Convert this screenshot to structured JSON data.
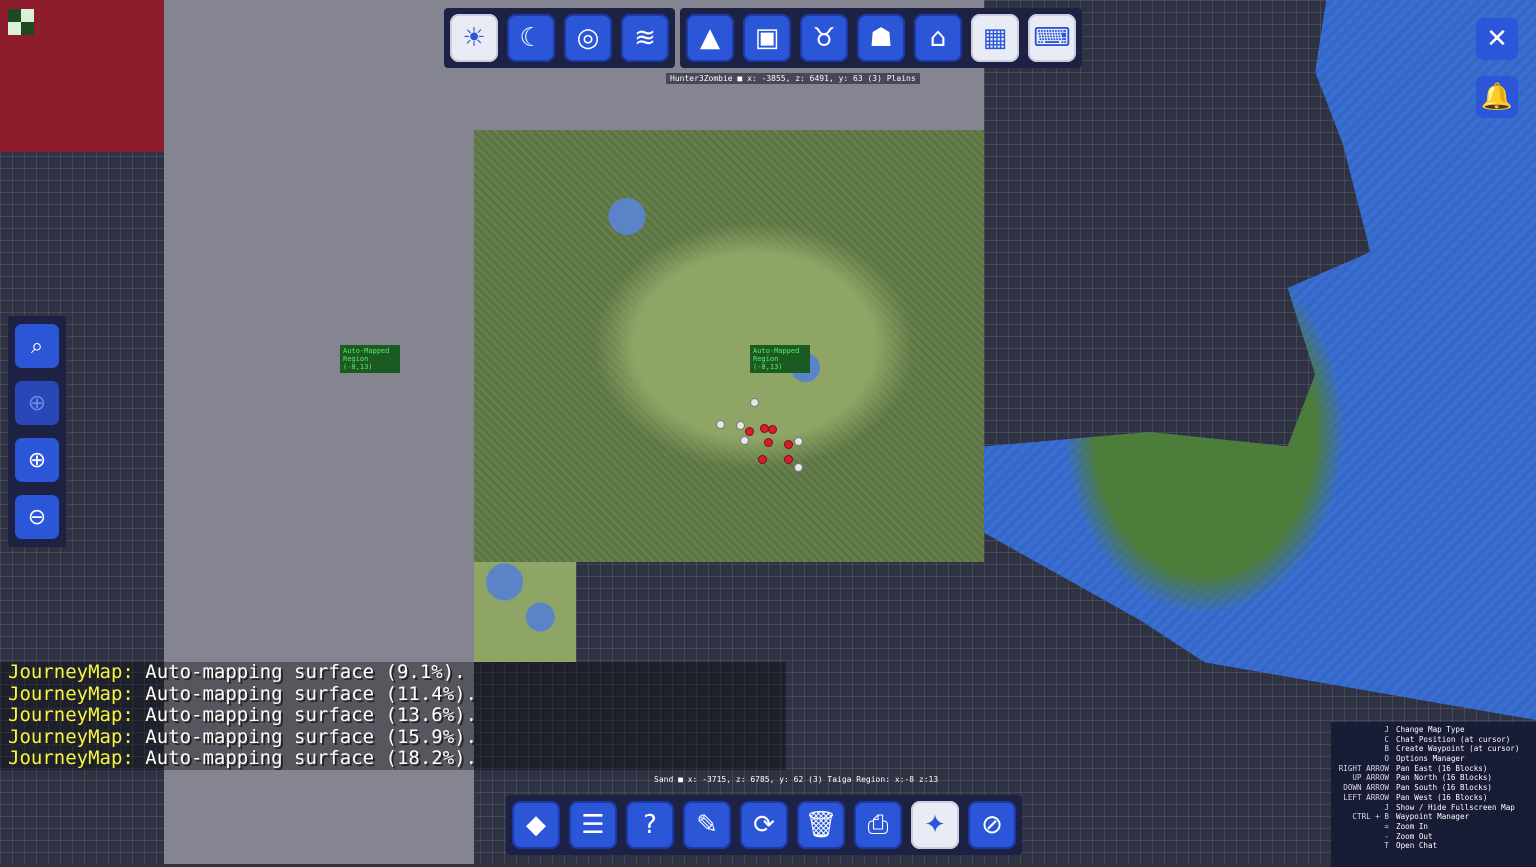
{
  "top_toolbar": {
    "left_group": [
      {
        "name": "day-map-button",
        "icon": "sun-icon",
        "glyph": "☀"
      },
      {
        "name": "night-map-button",
        "icon": "moon-icon",
        "glyph": "☾"
      },
      {
        "name": "topo-map-button",
        "icon": "topo-icon",
        "glyph": "◎"
      },
      {
        "name": "layers-button",
        "icon": "layers-icon",
        "glyph": "≋"
      }
    ],
    "right_group": [
      {
        "name": "caves-button",
        "icon": "mountain-icon",
        "glyph": "▲"
      },
      {
        "name": "players-button",
        "icon": "creeper-icon",
        "glyph": "▣"
      },
      {
        "name": "animals-button",
        "icon": "cow-icon",
        "glyph": "♉"
      },
      {
        "name": "pets-button",
        "icon": "cat-icon",
        "glyph": "☗"
      },
      {
        "name": "villagers-button",
        "icon": "villager-icon",
        "glyph": "⌂"
      },
      {
        "name": "grid-button",
        "icon": "grid-icon",
        "glyph": "▦"
      },
      {
        "name": "keybinds-button",
        "icon": "keyboard-icon",
        "glyph": "⌨"
      }
    ]
  },
  "player_location": "Hunter3Zombie ■ x: -3855, z: 6491, y: 63 (3) Plains",
  "cursor_location": "Sand ■ x: -3715, z: 6785, y: 62 (3) Taiga Region: x:-8 z:13",
  "region_labels": [
    {
      "text": "Auto-Mapped Region (-8,13)"
    },
    {
      "text": "Auto-Mapped Region (-8,13)"
    }
  ],
  "sidebar": [
    {
      "name": "search-button",
      "glyph": "⌕"
    },
    {
      "name": "center-on-player-button",
      "glyph": "⊕"
    },
    {
      "name": "zoom-in-button",
      "glyph": "⊕"
    },
    {
      "name": "zoom-out-button",
      "glyph": "⊖"
    }
  ],
  "chat": [
    {
      "tag": "JourneyMap:",
      "msg": "Auto-mapping surface (9.1%)."
    },
    {
      "tag": "JourneyMap:",
      "msg": "Auto-mapping surface (11.4%)."
    },
    {
      "tag": "JourneyMap:",
      "msg": "Auto-mapping surface (13.6%)."
    },
    {
      "tag": "JourneyMap:",
      "msg": "Auto-mapping surface (15.9%)."
    },
    {
      "tag": "JourneyMap:",
      "msg": "Auto-mapping surface (18.2%)."
    }
  ],
  "corner_buttons": [
    {
      "name": "close-button",
      "glyph": "✕"
    },
    {
      "name": "notifications-button",
      "glyph": "🔔"
    }
  ],
  "keybindings": [
    {
      "key": "J",
      "desc": "Change Map Type"
    },
    {
      "key": "C",
      "desc": "Chat Position (at cursor)"
    },
    {
      "key": "B",
      "desc": "Create Waypoint (at cursor)"
    },
    {
      "key": "O",
      "desc": "Options Manager"
    },
    {
      "key": "RIGHT ARROW",
      "desc": "Pan East (16 Blocks)"
    },
    {
      "key": "UP ARROW",
      "desc": "Pan North (16 Blocks)"
    },
    {
      "key": "DOWN ARROW",
      "desc": "Pan South (16 Blocks)"
    },
    {
      "key": "LEFT ARROW",
      "desc": "Pan West (16 Blocks)"
    },
    {
      "key": "J",
      "desc": "Show / Hide Fullscreen Map"
    },
    {
      "key": "CTRL + B",
      "desc": "Waypoint Manager"
    },
    {
      "key": "=",
      "desc": "Zoom In"
    },
    {
      "key": "-",
      "desc": "Zoom Out"
    },
    {
      "key": "T",
      "desc": "Open Chat"
    }
  ],
  "bottom_toolbar": [
    {
      "name": "waypoints-button",
      "glyph": "◆",
      "style": "blue"
    },
    {
      "name": "options-button",
      "glyph": "☰",
      "style": "blue"
    },
    {
      "name": "help-button",
      "glyph": "?",
      "style": "blue"
    },
    {
      "name": "theme-button",
      "glyph": "✎",
      "style": "blue"
    },
    {
      "name": "refresh-button",
      "glyph": "⟳",
      "style": "blue"
    },
    {
      "name": "delete-button",
      "glyph": "🗑",
      "style": "blue"
    },
    {
      "name": "export-button",
      "glyph": "⎙",
      "style": "blue"
    },
    {
      "name": "automap-button",
      "glyph": "✦",
      "style": "light"
    },
    {
      "name": "disable-button",
      "glyph": "⊘",
      "style": "blue"
    }
  ]
}
